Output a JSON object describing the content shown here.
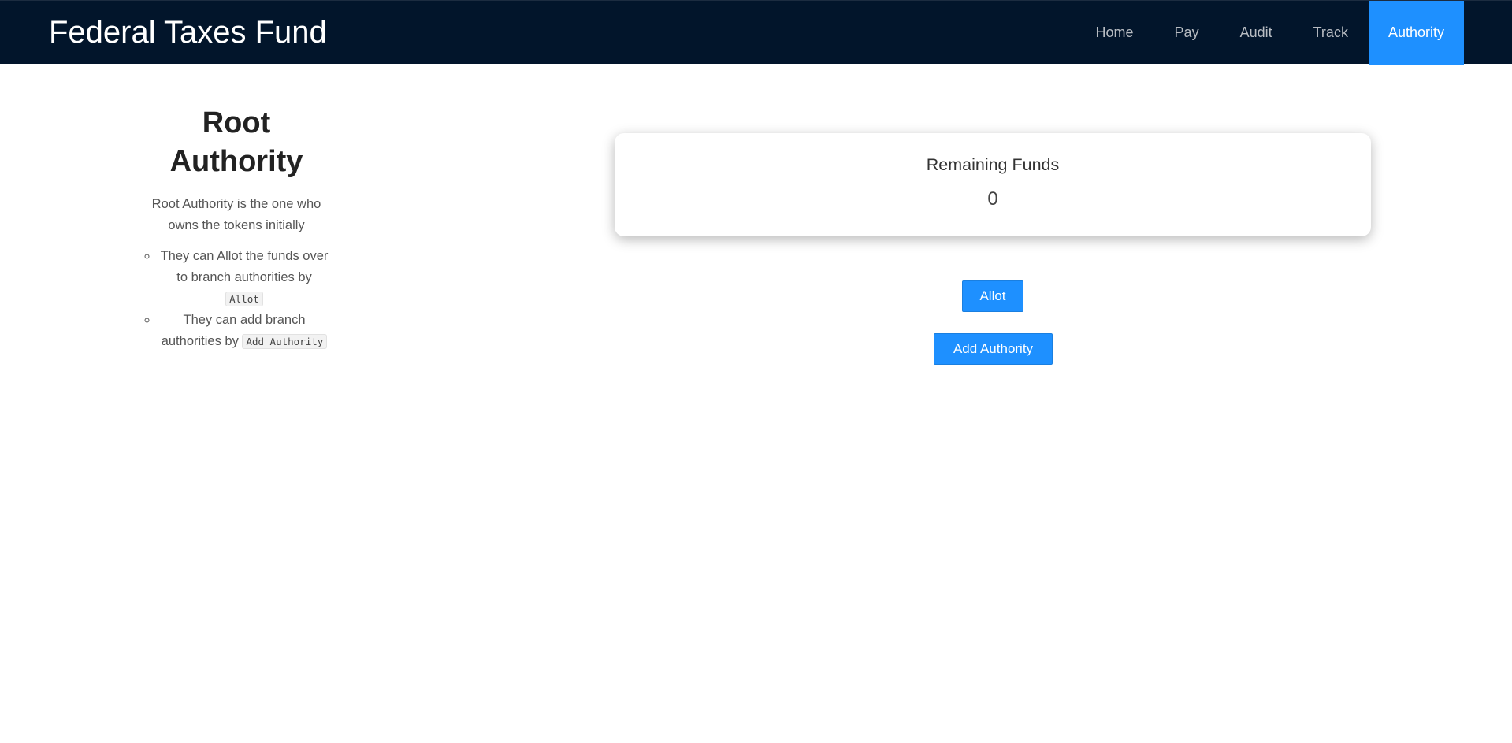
{
  "app": {
    "title": "Federal Taxes Fund"
  },
  "nav": {
    "items": [
      {
        "label": "Home"
      },
      {
        "label": "Pay"
      },
      {
        "label": "Audit"
      },
      {
        "label": "Track"
      },
      {
        "label": "Authority",
        "active": true
      }
    ]
  },
  "sidebar": {
    "heading_line1": "Root",
    "heading_line2": "Authority",
    "description": "Root Authority is the one who owns the tokens initially",
    "bullets": [
      {
        "text": "They can Allot the funds over to branch authorities by",
        "code": "Allot"
      },
      {
        "text": "They can add branch authorities by",
        "code": "Add Authority"
      }
    ]
  },
  "funds": {
    "label": "Remaining Funds",
    "value": "0"
  },
  "actions": {
    "allot_label": "Allot",
    "add_authority_label": "Add Authority"
  },
  "colors": {
    "navbar_bg": "#02152b",
    "accent": "#1e90ff"
  }
}
